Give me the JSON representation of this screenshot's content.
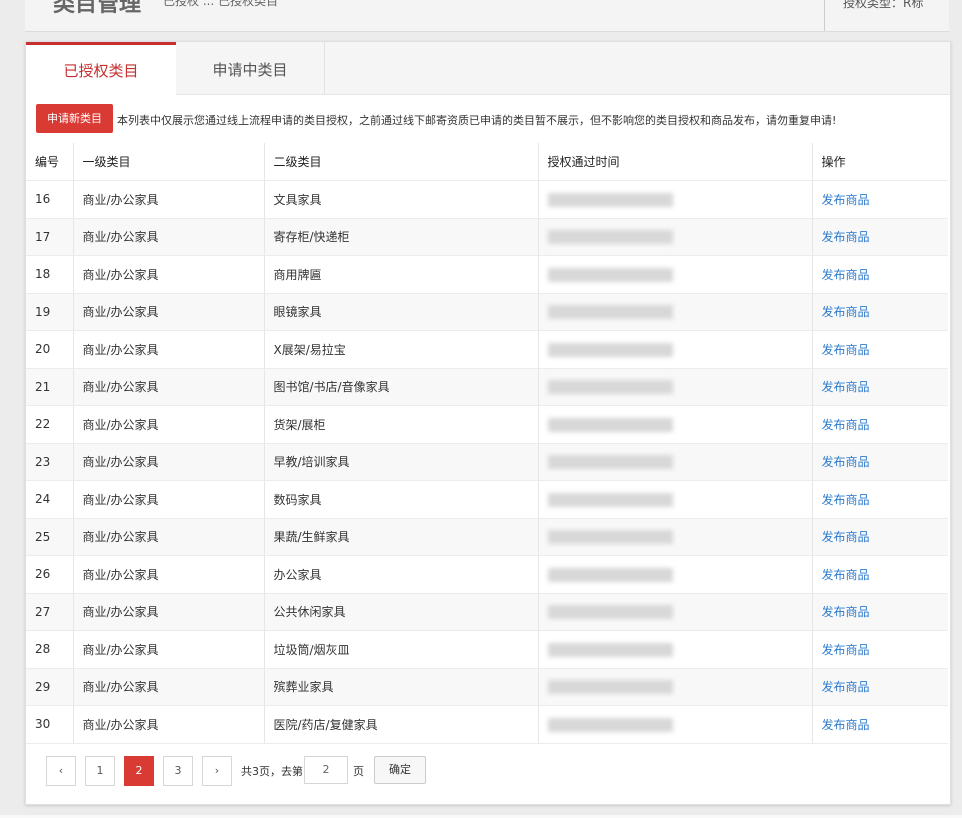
{
  "header": {
    "title": "类目管理",
    "subtitle": "已授权 ... 已授权类目",
    "auth_type": "授权类型：R标"
  },
  "tabs": [
    {
      "label": "已授权类目",
      "active": true
    },
    {
      "label": "申请中类目",
      "active": false
    }
  ],
  "notice": {
    "button_label": "申请新类目",
    "text": "本列表中仅展示您通过线上流程申请的类目授权，之前通过线下邮寄资质已申请的类目暂不展示，但不影响您的类目授权和商品发布，请勿重复申请!"
  },
  "table": {
    "headers": [
      "编号",
      "一级类目",
      "二级类目",
      "授权通过时间",
      "操作"
    ],
    "rows": [
      {
        "id": "16",
        "cat1": "商业/办公家具",
        "cat2": "文具家具",
        "action": "发布商品"
      },
      {
        "id": "17",
        "cat1": "商业/办公家具",
        "cat2": "寄存柜/快递柜",
        "action": "发布商品"
      },
      {
        "id": "18",
        "cat1": "商业/办公家具",
        "cat2": "商用牌匾",
        "action": "发布商品"
      },
      {
        "id": "19",
        "cat1": "商业/办公家具",
        "cat2": "眼镜家具",
        "action": "发布商品"
      },
      {
        "id": "20",
        "cat1": "商业/办公家具",
        "cat2": "X展架/易拉宝",
        "action": "发布商品"
      },
      {
        "id": "21",
        "cat1": "商业/办公家具",
        "cat2": "图书馆/书店/音像家具",
        "action": "发布商品"
      },
      {
        "id": "22",
        "cat1": "商业/办公家具",
        "cat2": "货架/展柜",
        "action": "发布商品"
      },
      {
        "id": "23",
        "cat1": "商业/办公家具",
        "cat2": "早教/培训家具",
        "action": "发布商品"
      },
      {
        "id": "24",
        "cat1": "商业/办公家具",
        "cat2": "数码家具",
        "action": "发布商品"
      },
      {
        "id": "25",
        "cat1": "商业/办公家具",
        "cat2": "果蔬/生鲜家具",
        "action": "发布商品"
      },
      {
        "id": "26",
        "cat1": "商业/办公家具",
        "cat2": "办公家具",
        "action": "发布商品"
      },
      {
        "id": "27",
        "cat1": "商业/办公家具",
        "cat2": "公共休闲家具",
        "action": "发布商品"
      },
      {
        "id": "28",
        "cat1": "商业/办公家具",
        "cat2": "垃圾筒/烟灰皿",
        "action": "发布商品"
      },
      {
        "id": "29",
        "cat1": "商业/办公家具",
        "cat2": "殡葬业家具",
        "action": "发布商品"
      },
      {
        "id": "30",
        "cat1": "商业/办公家具",
        "cat2": "医院/药店/复健家具",
        "action": "发布商品"
      }
    ]
  },
  "pagination": {
    "prev": "‹",
    "next": "›",
    "pages": [
      "1",
      "2",
      "3"
    ],
    "current": "2",
    "total_text": "共3页，去第",
    "input_value": "2",
    "page_suffix": "页",
    "confirm_label": "确定"
  }
}
